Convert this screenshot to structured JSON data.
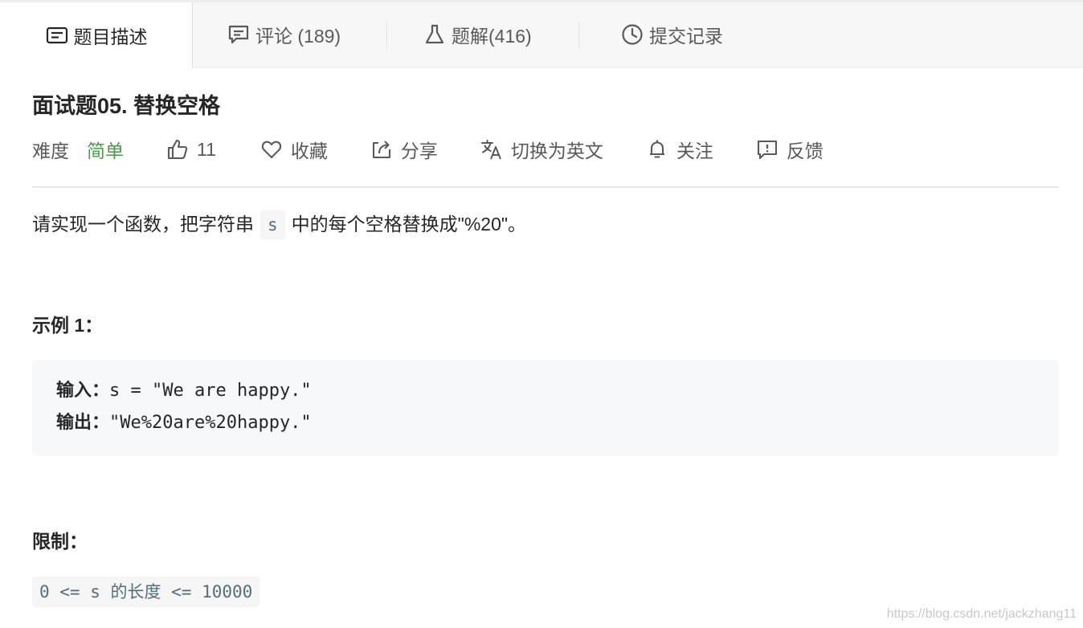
{
  "tabs": [
    {
      "label": "题目描述",
      "icon": "description-icon",
      "active": true
    },
    {
      "label": "评论 (189)",
      "icon": "comment-icon",
      "active": false
    },
    {
      "label": "题解(416)",
      "icon": "flask-icon",
      "active": false
    },
    {
      "label": "提交记录",
      "icon": "clock-icon",
      "active": false
    }
  ],
  "problem": {
    "title": "面试题05. 替换空格",
    "difficulty_label": "难度",
    "difficulty_value": "简单",
    "difficulty_color": "#43a047",
    "likes": "11",
    "actions": {
      "favorite": "收藏",
      "share": "分享",
      "translate": "切换为英文",
      "follow": "关注",
      "feedback": "反馈"
    }
  },
  "description": {
    "before_code": "请实现一个函数，把字符串",
    "inline_code": "s",
    "after_code": "中的每个空格替换成\"%20\"。"
  },
  "example": {
    "heading": "示例 1：",
    "input_label": "输入：",
    "input_value": "s = \"We are happy.\"",
    "output_label": "输出：",
    "output_value": "\"We%20are%20happy.\""
  },
  "limits": {
    "heading": "限制：",
    "constraint": "0 <= s 的长度 <= 10000"
  },
  "watermark": "https://blog.csdn.net/jackzhang11"
}
